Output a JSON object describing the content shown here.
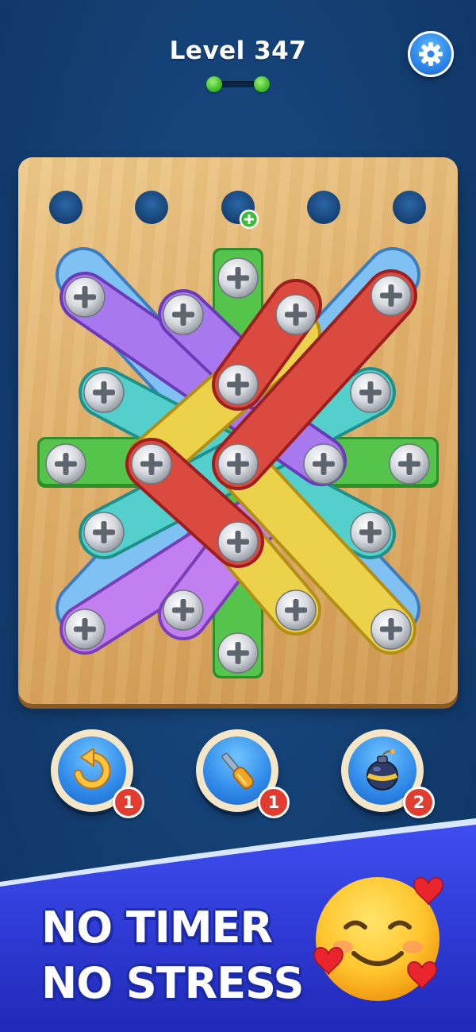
{
  "header": {
    "level_label": "Level 347",
    "stage_progress": {
      "stages": 2,
      "completed": 2
    },
    "settings_icon": "gear-icon"
  },
  "board": {
    "empty_holes": 5,
    "hole_bonus_icon": "plus-icon",
    "plank_colors": [
      "purple",
      "cyan",
      "green",
      "red",
      "yellow",
      "blue"
    ],
    "screw_icon": "screw-icon"
  },
  "boosters": [
    {
      "name": "undo",
      "icon": "undo-arrow-icon",
      "count": "1"
    },
    {
      "name": "screwdriver",
      "icon": "screwdriver-icon",
      "count": "1"
    },
    {
      "name": "bomb",
      "icon": "bomb-icon",
      "count": "2"
    }
  ],
  "promo": {
    "line1": "NO TIMER",
    "line2": "NO STRESS",
    "emoji_icon": "smiling-face-with-hearts-icon"
  },
  "colors": {
    "background": "#133f72",
    "board_wood": "#e2b36d",
    "hole": "#1d4f86",
    "banner": "#2a36d8",
    "badge": "#e23b2f"
  }
}
